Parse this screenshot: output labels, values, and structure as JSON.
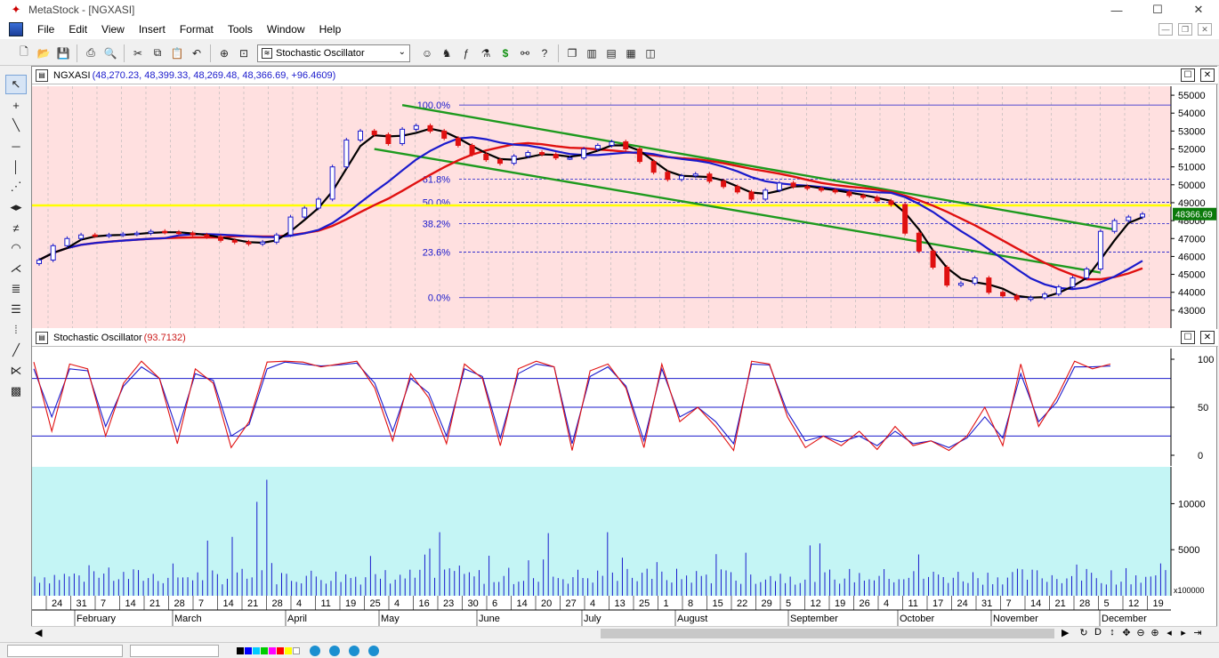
{
  "window": {
    "title": "MetaStock - [NGXASI]",
    "minimize": "—",
    "maximize": "☐",
    "close": "✕"
  },
  "menu": [
    "File",
    "Edit",
    "View",
    "Insert",
    "Format",
    "Tools",
    "Window",
    "Help"
  ],
  "toolbar": {
    "indicator_select": "Stochastic Oscillator"
  },
  "price_pane": {
    "symbol": "NGXASI",
    "values": "(48,270.23, 48,399.33, 48,269.48, 48,366.69, +96.4609)",
    "last_price_label": "48366.69",
    "y_ticks": [
      43000,
      44000,
      45000,
      46000,
      47000,
      48000,
      49000,
      50000,
      51000,
      52000,
      53000,
      54000,
      55000
    ],
    "y_range": [
      42000,
      55500
    ],
    "fib_levels": [
      {
        "label": "100.0%",
        "value": 54450
      },
      {
        "label": "61.8%",
        "value": 50320
      },
      {
        "label": "50.0%",
        "value": 49020
      },
      {
        "label": "38.2%",
        "value": 47830
      },
      {
        "label": "23.6%",
        "value": 46240
      },
      {
        "label": "0.0%",
        "value": 43700
      }
    ],
    "resistance_line": 48850,
    "colors": {
      "background": "#ffe0e0",
      "candle_up": "#1a1acc",
      "candle_down": "#e01010",
      "ma_short": "#000000",
      "ma_mid": "#1a1acc",
      "ma_long": "#e01010",
      "trend": "#1e9a1e",
      "resistance": "#ffff00"
    }
  },
  "stoch_pane": {
    "title": "Stochastic Oscillator",
    "value": "(93.7132)",
    "y_ticks": [
      0,
      50,
      100
    ],
    "levels": [
      20,
      50,
      80
    ],
    "colors": {
      "k": "#e01010",
      "d": "#1a1acc",
      "background": "#ffffff"
    }
  },
  "volume_pane": {
    "y_ticks": [
      5000,
      10000
    ],
    "multiplier": "x100000",
    "colors": {
      "background": "#c4f5f5",
      "bar": "#1a1acc"
    }
  },
  "x_axis": {
    "day_ticks": [
      "24",
      "31",
      "7",
      "14",
      "21",
      "28",
      "7",
      "14",
      "21",
      "28",
      "4",
      "11",
      "19",
      "25",
      "4",
      "16",
      "23",
      "30",
      "6",
      "14",
      "20",
      "27",
      "4",
      "13",
      "25",
      "1",
      "8",
      "15",
      "22",
      "29",
      "5",
      "12",
      "19",
      "26",
      "4",
      "11",
      "17",
      "24",
      "31",
      "7",
      "14",
      "21",
      "28",
      "5",
      "12",
      "19"
    ],
    "months": [
      "February",
      "March",
      "April",
      "May",
      "June",
      "July",
      "August",
      "September",
      "October",
      "November",
      "December"
    ]
  },
  "chart_data": [
    {
      "type": "candlestick",
      "title": "NGXASI",
      "y_range": [
        42000,
        55500
      ],
      "series": [
        {
          "name": "price",
          "values": [
            45800,
            46600,
            47000,
            47200,
            47150,
            47200,
            47250,
            47300,
            47400,
            47350,
            47300,
            47200,
            47100,
            46900,
            46800,
            46700,
            46800,
            47200,
            48200,
            48700,
            49200,
            51000,
            52500,
            53000,
            52800,
            52300,
            53100,
            53300,
            53000,
            52600,
            52200,
            51700,
            51400,
            51200,
            51600,
            51800,
            51700,
            51500,
            51500,
            52000,
            52200,
            52400,
            52000,
            51300,
            50700,
            50300,
            50500,
            50600,
            50200,
            49900,
            49600,
            49200,
            49700,
            50100,
            49900,
            49800,
            49700,
            49600,
            49400,
            49300,
            49100,
            48900,
            47300,
            46300,
            45400,
            44400,
            44500,
            44800,
            44000,
            43800,
            43600,
            43700,
            43900,
            44300,
            44800,
            45300,
            47400,
            48000,
            48200,
            48366.69
          ]
        }
      ]
    },
    {
      "type": "line",
      "title": "Stochastic Oscillator",
      "y_range": [
        0,
        100
      ],
      "series": [
        {
          "name": "%K",
          "values": [
            97,
            25,
            95,
            90,
            20,
            75,
            98,
            80,
            12,
            90,
            75,
            8,
            35,
            97,
            98,
            97,
            92,
            95,
            98,
            70,
            15,
            85,
            60,
            12,
            95,
            80,
            10,
            90,
            98,
            92,
            5,
            88,
            95,
            70,
            8,
            95,
            35,
            50,
            30,
            5,
            98,
            95,
            40,
            8,
            20,
            10,
            25,
            6,
            30,
            10,
            15,
            5,
            20,
            50,
            10,
            95,
            30,
            60,
            98,
            90,
            95
          ]
        },
        {
          "name": "%D",
          "values": [
            90,
            40,
            90,
            88,
            30,
            72,
            92,
            80,
            25,
            85,
            78,
            20,
            32,
            90,
            97,
            95,
            93,
            94,
            96,
            75,
            25,
            80,
            65,
            20,
            90,
            82,
            18,
            85,
            95,
            92,
            12,
            82,
            92,
            72,
            15,
            90,
            40,
            50,
            35,
            12,
            95,
            94,
            45,
            15,
            20,
            14,
            20,
            10,
            25,
            12,
            15,
            8,
            18,
            40,
            18,
            85,
            35,
            55,
            92,
            92,
            93
          ]
        }
      ]
    }
  ]
}
